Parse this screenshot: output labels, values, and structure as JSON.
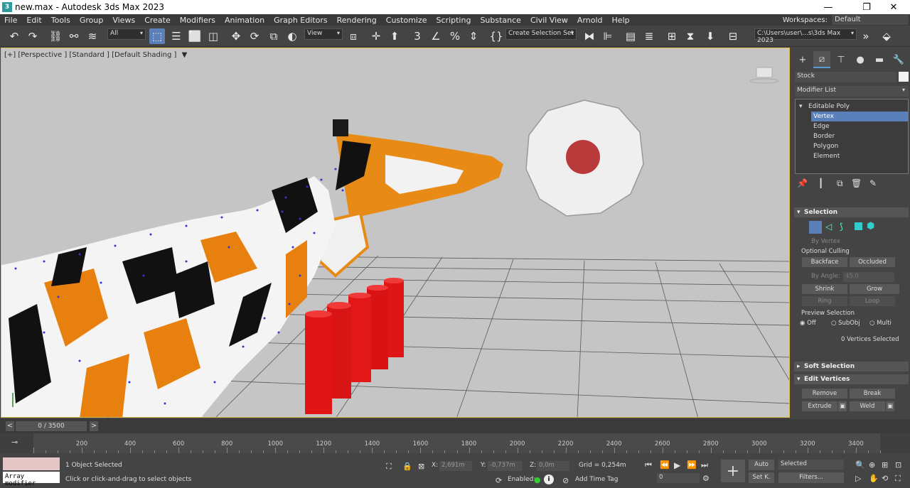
{
  "window": {
    "title": "new.max - Autodesk 3ds Max 2023",
    "app_icon": "3"
  },
  "menu": {
    "items": [
      "File",
      "Edit",
      "Tools",
      "Group",
      "Views",
      "Create",
      "Modifiers",
      "Animation",
      "Graph Editors",
      "Rendering",
      "Customize",
      "Scripting",
      "Substance",
      "Civil View",
      "Arnold",
      "Help"
    ],
    "workspaces_label": "Workspaces:",
    "workspace_value": "Default"
  },
  "toolbar": {
    "filter_value": "All",
    "ref_coord_value": "View",
    "selection_set_value": "Create Selection Set",
    "project_path": "C:\\Users\\user\\...s\\3ds Max 2023"
  },
  "viewport": {
    "label": "[+] [Perspective ] [Standard ] [Default Shading ]",
    "accent_color": "#e0c04a"
  },
  "command_panel": {
    "object_name": "Stock",
    "modifier_list": "Modifier List",
    "stack": {
      "root": "Editable Poly",
      "subobjects": [
        "Vertex",
        "Edge",
        "Border",
        "Polygon",
        "Element"
      ],
      "selected": "Vertex"
    },
    "selection": {
      "title": "Selection",
      "by_vertex": "By Vertex",
      "optional_culling": "Optional Culling",
      "backface": "Backface",
      "occluded": "Occluded",
      "by_angle": "By Angle:",
      "angle_value": "45,0",
      "shrink": "Shrink",
      "grow": "Grow",
      "ring": "Ring",
      "loop": "Loop",
      "preview_selection": "Preview Selection",
      "preview_options": [
        "Off",
        "SubObj",
        "Multi"
      ],
      "status": "0 Vertices Selected"
    },
    "soft_selection": "Soft Selection",
    "edit_vertices": {
      "title": "Edit Vertices",
      "remove": "Remove",
      "break": "Break",
      "extrude": "Extrude",
      "weld": "Weld"
    }
  },
  "timeline": {
    "frame_display": "0 / 3500",
    "ticks": [
      "200",
      "400",
      "600",
      "800",
      "1000",
      "1200",
      "1400",
      "1600",
      "1800",
      "2000",
      "2200",
      "2400",
      "2600",
      "2800",
      "3000",
      "3200",
      "3400"
    ]
  },
  "status": {
    "script_listener": "Array modifier",
    "selection_info": "1 Object Selected",
    "prompt": "Click or click-and-drag to select objects",
    "x_label": "X:",
    "x_value": "2,691m",
    "y_label": "Y:",
    "y_value": "-0,737m",
    "z_label": "Z:",
    "z_value": "0,0m",
    "grid": "Grid = 0,254m",
    "enabled_label": "Enabled:",
    "add_time_tag": "Add Time Tag",
    "auto": "Auto",
    "set_k": "Set K.",
    "selected_value": "Selected",
    "filters": "Filters...",
    "frame_value": "0"
  }
}
